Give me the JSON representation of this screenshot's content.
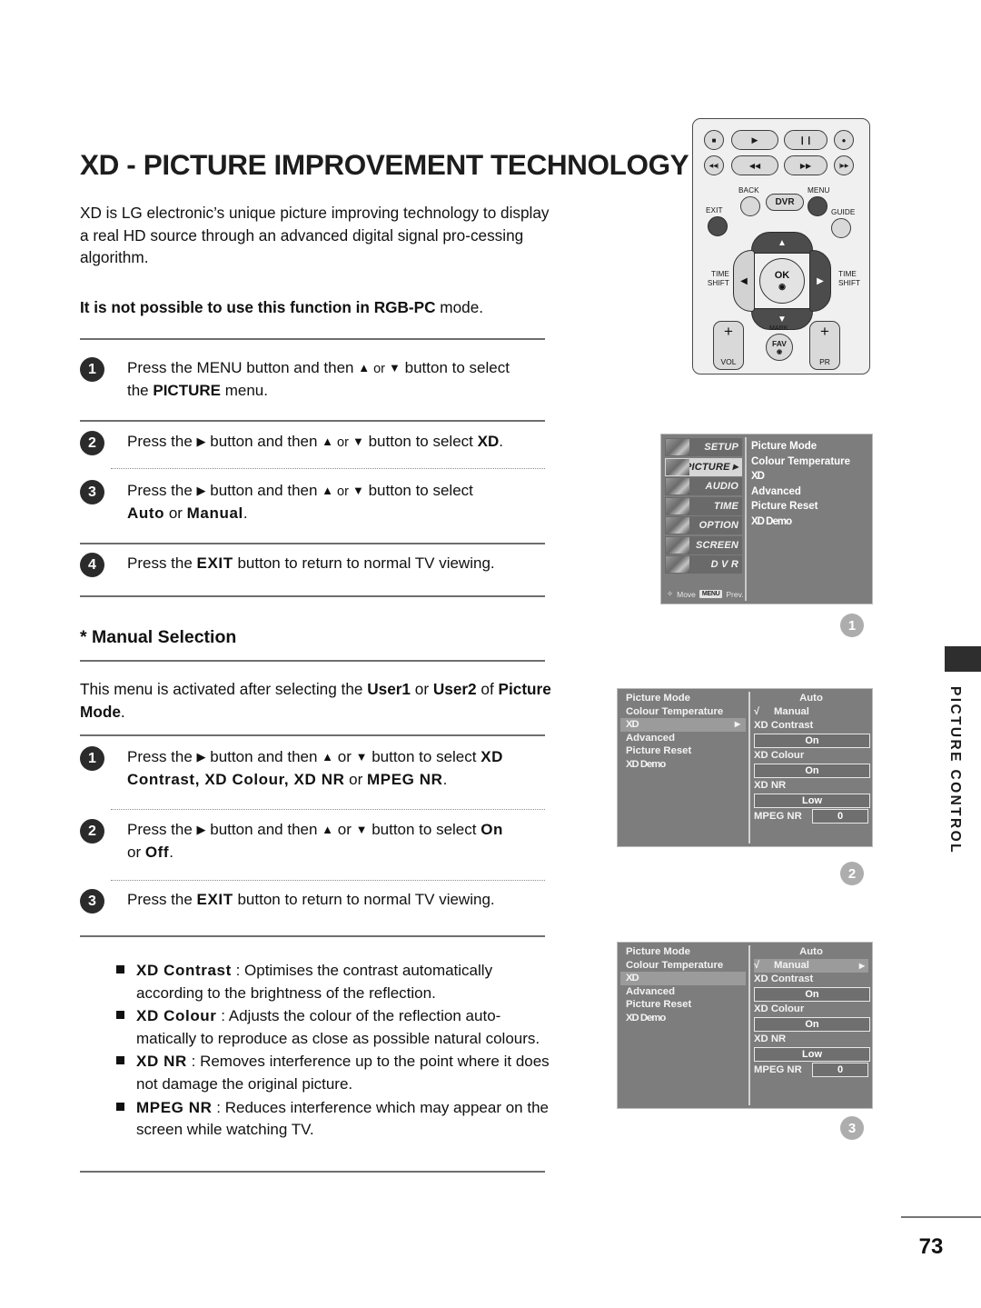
{
  "page": {
    "title": "XD - PICTURE IMPROVEMENT TECHNOLOGY",
    "number": "73",
    "side_tab": "PICTURE CONTROL"
  },
  "intro": {
    "paragraph": "XD is LG electronic’s unique picture improving technology to display a real HD source through an advanced digital signal pro-cessing algorithm.",
    "note_bold": "It is not possible to use this function in RGB-PC",
    "note_rest": " mode."
  },
  "steps_main": [
    {
      "num": "1",
      "line1_a": "Press the MENU button and then ",
      "tri_up": "▲",
      "or": " or ",
      "tri_dn": "▼",
      "line1_b": " button to select",
      "line2_a": "the ",
      "line2_bold": "PICTURE",
      "line2_b": " menu."
    },
    {
      "num": "2",
      "line1_a": "Press the ",
      "tri_r": "▶",
      "line1_b": " button and then ",
      "tri_up": "▲",
      "or": " or ",
      "tri_dn": "▼",
      "line1_c": " button to select ",
      "line1_bold": "XD",
      "line1_d": "."
    },
    {
      "num": "3",
      "line1_a": "Press the ",
      "tri_r": "▶",
      "line1_b": " button and then ",
      "tri_up": "▲",
      "or": " or ",
      "tri_dn": "▼",
      "line1_c": " button to select",
      "line2_bold1": "Auto",
      "line2_mid": " or ",
      "line2_bold2": "Manual",
      "line2_end": "."
    },
    {
      "num": "4",
      "line1_a": "Press the ",
      "line1_bold": "EXIT",
      "line1_b": " button to return to normal TV viewing."
    }
  ],
  "manual": {
    "heading": "* Manual Selection",
    "body_a": "This menu is activated after selecting the ",
    "body_b1": "User1",
    "body_mid": " or ",
    "body_b2": "User2",
    "body_c": " of ",
    "body_b3": "Picture Mode",
    "body_end": "."
  },
  "steps_manual": [
    {
      "num": "1",
      "line1_a": "Press the ",
      "tri_r": "▶",
      "line1_b": " button and then ",
      "tri_up": "▲",
      "or": " or ",
      "tri_dn": "▼",
      "line1_c": " button to select ",
      "line1_bold": "XD",
      "line2_bold": "Contrast, XD Colour, XD NR",
      "line2_mid": " or ",
      "line2_bold2": "MPEG NR",
      "line2_end": "."
    },
    {
      "num": "2",
      "line1_a": "Press the ",
      "tri_r": "▶",
      "line1_b": " button and then ",
      "tri_up": "▲",
      "or": " or ",
      "tri_dn": "▼",
      "line1_c": " button to select ",
      "line1_bold": "On",
      "line2_a": "or ",
      "line2_bold": "Off",
      "line2_end": "."
    },
    {
      "num": "3",
      "line1_a": "Press the ",
      "line1_bold": "EXIT",
      "line1_b": " button to return to normal TV viewing."
    }
  ],
  "bullets": [
    {
      "term": "XD Contrast",
      "sep": " : ",
      "desc": "Optimises the contrast automatically according to the brightness of the reflection."
    },
    {
      "term": "XD Colour",
      "sep": " : ",
      "desc": "Adjusts the colour of the reflection auto-matically to reproduce as close as possible natural colours."
    },
    {
      "term": "XD NR",
      "sep": " : ",
      "desc": "Removes interference up to the point where it does not damage the original picture."
    },
    {
      "term": "MPEG NR",
      "sep": " : ",
      "desc": "Reduces interference which may appear on the screen while watching TV."
    }
  ],
  "remote": {
    "transport_row1": [
      {
        "icon": "stop-icon",
        "glyph": "■"
      },
      {
        "icon": "play-icon",
        "glyph": "▶"
      },
      {
        "icon": "pause-icon",
        "glyph": "❙❙"
      },
      {
        "icon": "record-icon",
        "glyph": "●"
      }
    ],
    "transport_row2": [
      {
        "icon": "skip-back-icon",
        "glyph": "◀◀|"
      },
      {
        "icon": "rewind-icon",
        "glyph": "◀◀"
      },
      {
        "icon": "fast-forward-icon",
        "glyph": "▶▶"
      },
      {
        "icon": "skip-forward-icon",
        "glyph": "|▶▶"
      }
    ],
    "back_label": "BACK",
    "dvr_label": "DVR",
    "menu_label": "MENU",
    "exit_label": "EXIT",
    "guide_label": "GUIDE",
    "timeshift_left": "TIME\nSHIFT",
    "timeshift_right": "TIME\nSHIFT",
    "ok_label": "OK",
    "up_glyph": "▲",
    "down_glyph": "▼",
    "left_glyph": "◀",
    "right_glyph": "▶",
    "vol_label": "VOL",
    "pr_label": "PR",
    "plus": "+",
    "mark_label": "MARK",
    "fav_label": "FAV"
  },
  "osd1": {
    "marker": "1",
    "nav": [
      {
        "label": "SETUP",
        "selected": false,
        "arrow": ""
      },
      {
        "label": "PICTURE",
        "selected": true,
        "arrow": "▶"
      },
      {
        "label": "AUDIO",
        "selected": false,
        "arrow": ""
      },
      {
        "label": "TIME",
        "selected": false,
        "arrow": ""
      },
      {
        "label": "OPTION",
        "selected": false,
        "arrow": ""
      },
      {
        "label": "SCREEN",
        "selected": false,
        "arrow": ""
      },
      {
        "label": "D V R",
        "selected": false,
        "arrow": ""
      }
    ],
    "items": [
      "Picture Mode",
      "Colour Temperature",
      "XD",
      "Advanced",
      "Picture Reset",
      "XD Demo"
    ],
    "footer_move": "Move",
    "footer_key": "MENU",
    "footer_prev": "Prev."
  },
  "osd2": {
    "marker": "2",
    "left_items": [
      {
        "label": "Picture Mode",
        "selected": false,
        "arrow": ""
      },
      {
        "label": "Colour Temperature",
        "selected": false,
        "arrow": ""
      },
      {
        "label": "XD",
        "selected": true,
        "arrow": "▶"
      },
      {
        "label": "Advanced",
        "selected": false,
        "arrow": ""
      },
      {
        "label": "Picture Reset",
        "selected": false,
        "arrow": ""
      },
      {
        "label": "XD Demo",
        "selected": false,
        "arrow": ""
      }
    ],
    "auto_label": "Auto",
    "manual_label": "Manual",
    "manual_check": "√",
    "manual_selected": false,
    "manual_arrow": "",
    "xd_contrast_label": "XD Contrast",
    "xd_contrast_value": "On",
    "xd_colour_label": "XD Colour",
    "xd_colour_value": "On",
    "xd_nr_label": "XD NR",
    "xd_nr_value": "Low",
    "mpeg_nr_label": "MPEG NR",
    "mpeg_nr_value": "0"
  },
  "osd3": {
    "marker": "3",
    "left_items": [
      {
        "label": "Picture Mode",
        "selected": false,
        "arrow": ""
      },
      {
        "label": "Colour Temperature",
        "selected": false,
        "arrow": ""
      },
      {
        "label": "XD",
        "selected": true,
        "arrow": ""
      },
      {
        "label": "Advanced",
        "selected": false,
        "arrow": ""
      },
      {
        "label": "Picture Reset",
        "selected": false,
        "arrow": ""
      },
      {
        "label": "XD Demo",
        "selected": false,
        "arrow": ""
      }
    ],
    "auto_label": "Auto",
    "manual_label": "Manual",
    "manual_check": "√",
    "manual_selected": true,
    "manual_arrow": "▶",
    "xd_contrast_label": "XD Contrast",
    "xd_contrast_value": "On",
    "xd_colour_label": "XD Colour",
    "xd_colour_value": "On",
    "xd_nr_label": "XD NR",
    "xd_nr_value": "Low",
    "mpeg_nr_label": "MPEG NR",
    "mpeg_nr_value": "0"
  }
}
